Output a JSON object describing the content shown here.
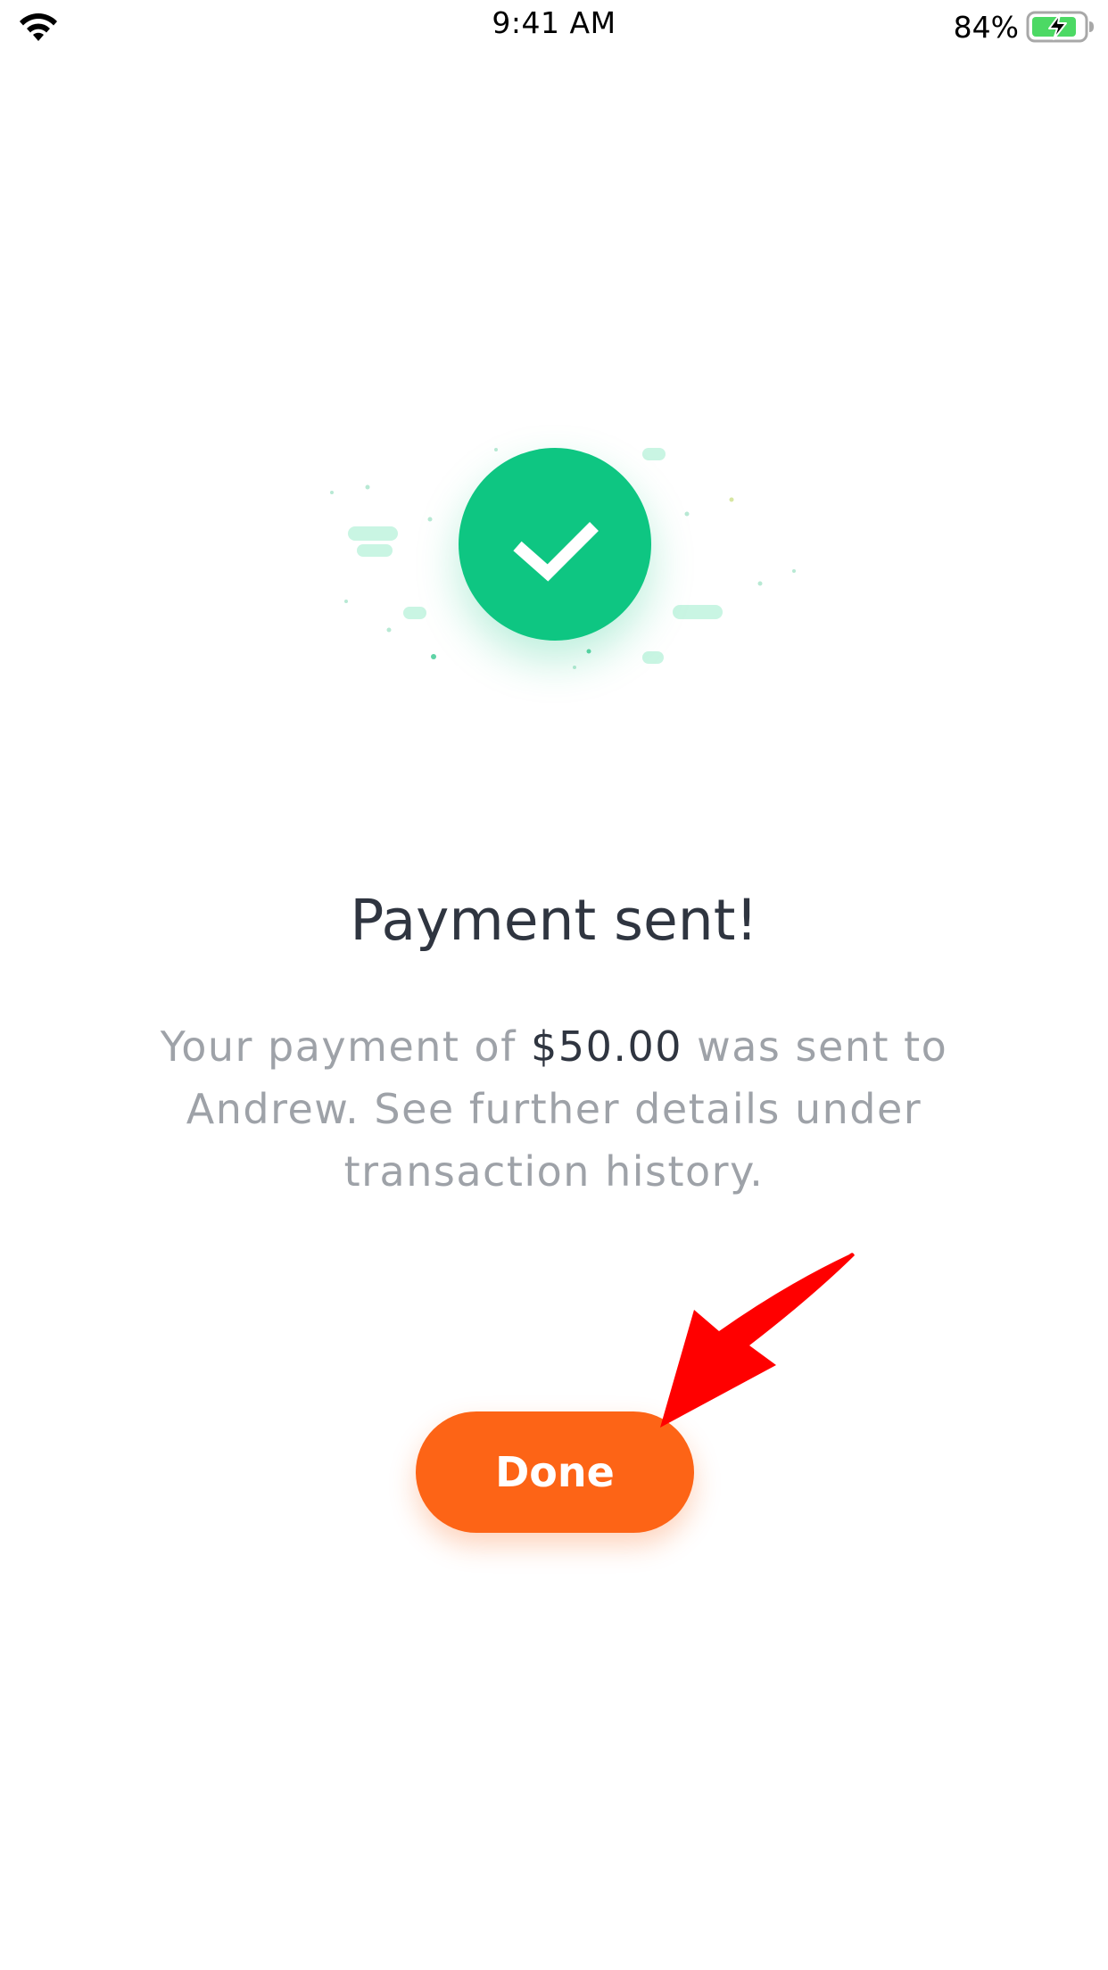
{
  "status_bar": {
    "time": "9:41 AM",
    "battery_percent": "84%",
    "battery_level": 0.84,
    "icons": [
      "wifi-icon",
      "battery-charging-icon"
    ]
  },
  "illustration": {
    "icon": "checkmark-icon",
    "circle_color": "#0ec682"
  },
  "confirmation": {
    "title": "Payment sent!",
    "message_before": "Your payment of ",
    "amount": "$50.00",
    "message_after": " was sent to Andrew. See further details under transaction history."
  },
  "actions": {
    "done_label": "Done",
    "done_color": "#fd6416"
  },
  "annotation": {
    "arrow_icon": "red-arrow-icon",
    "arrow_color": "#ff0000"
  }
}
